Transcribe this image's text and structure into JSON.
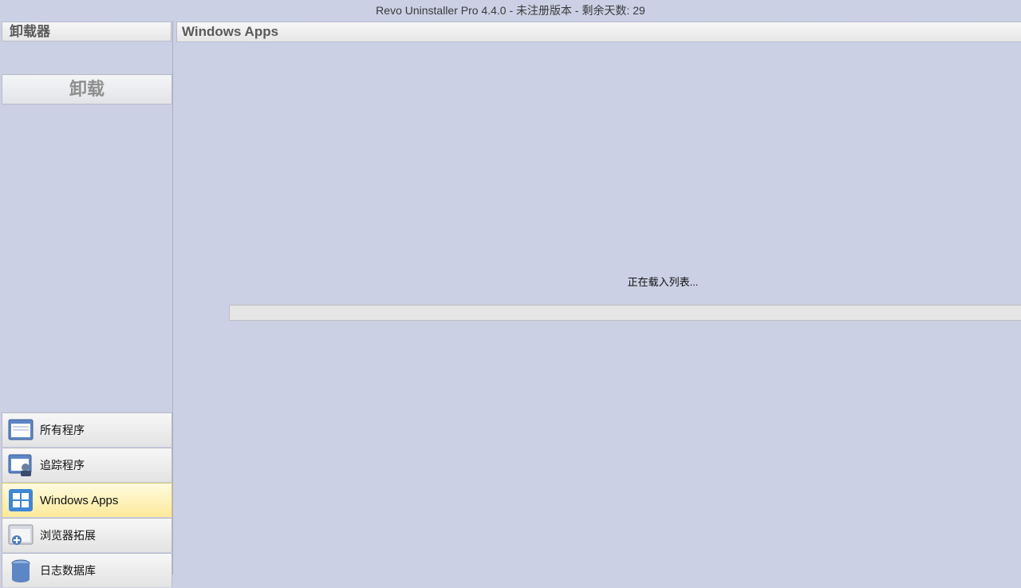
{
  "window": {
    "title": "Revo Uninstaller Pro 4.4.0 - 未注册版本 - 剩余天数: 29"
  },
  "left_panel": {
    "header": "卸载器",
    "uninstall_button": "卸载"
  },
  "nav": {
    "items": [
      {
        "label": "所有程序",
        "icon": "all-programs-icon"
      },
      {
        "label": "追踪程序",
        "icon": "traced-programs-icon"
      },
      {
        "label": "Windows Apps",
        "icon": "windows-apps-icon",
        "active": true
      },
      {
        "label": "浏览器拓展",
        "icon": "browser-extensions-icon"
      },
      {
        "label": "日志数据库",
        "icon": "logs-database-icon"
      }
    ]
  },
  "main": {
    "header": "Windows Apps",
    "loading_text": "正在载入列表...",
    "progress_percent": 0
  },
  "colors": {
    "background": "#cbd0e4",
    "active_item": "#fde99a",
    "progress_fill": "#06b025"
  }
}
